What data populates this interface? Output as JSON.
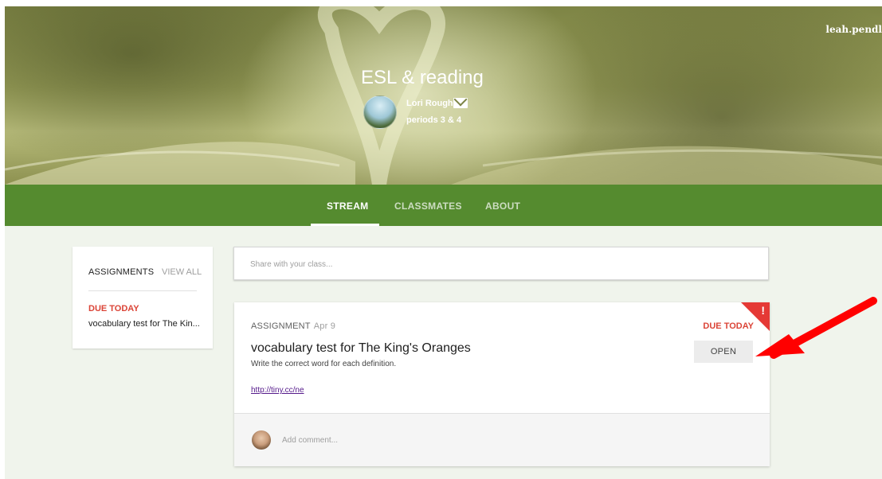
{
  "header": {
    "user_name": "leah.pendl",
    "course_title": "ESL & reading",
    "teacher_name": "Lori Rough",
    "section": "periods 3 & 4"
  },
  "nav": {
    "tabs": [
      {
        "label": "STREAM",
        "active": true
      },
      {
        "label": "CLASSMATES",
        "active": false
      },
      {
        "label": "ABOUT",
        "active": false
      }
    ]
  },
  "sidebar": {
    "heading": "ASSIGNMENTS",
    "view_all": "VIEW ALL",
    "due_label": "DUE TODAY",
    "item": "vocabulary test for The Kin..."
  },
  "share": {
    "placeholder": "Share with your class..."
  },
  "assignment": {
    "type_label": "ASSIGNMENT",
    "date": "Apr 9",
    "due_label": "DUE TODAY",
    "corner_mark": "!",
    "title": "vocabulary test for The King's Oranges",
    "description": "Write the correct word for each definition.",
    "link": "http://tiny.cc/ne",
    "open_label": "OPEN",
    "comment_placeholder": "Add comment..."
  },
  "colors": {
    "nav_green": "#558b2f",
    "due_red": "#db4437",
    "annotation_arrow": "#ff0000"
  }
}
